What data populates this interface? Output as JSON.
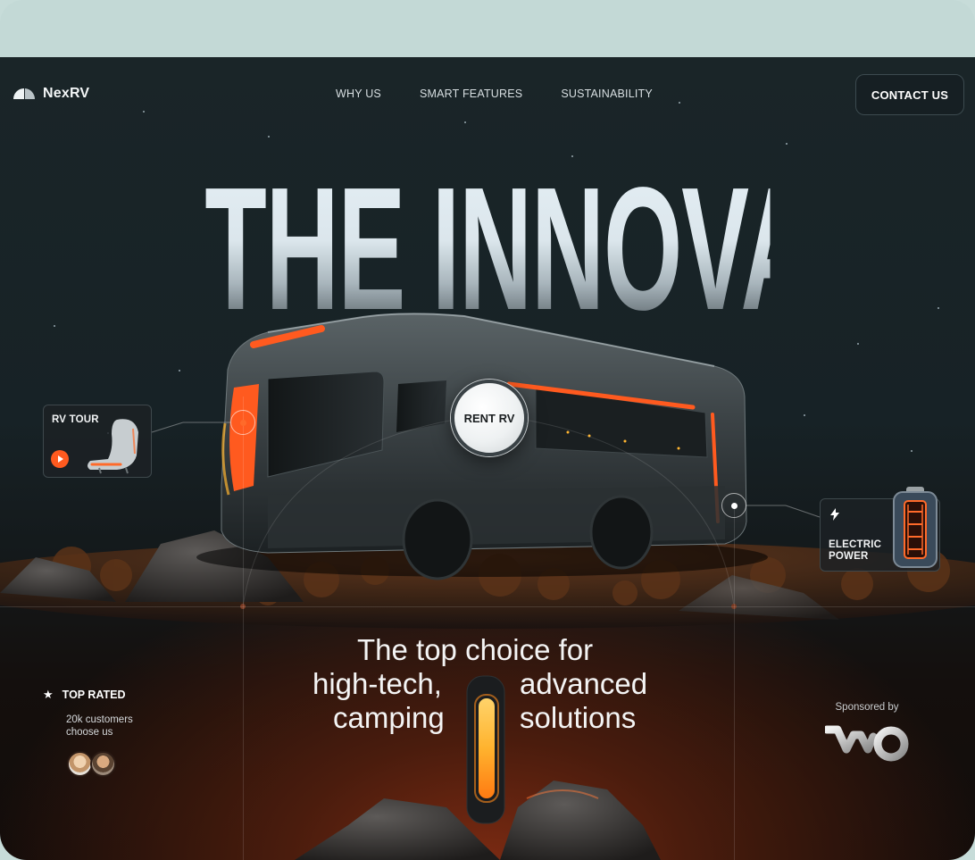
{
  "brand": {
    "name": "NexRV"
  },
  "nav": {
    "items": [
      {
        "label": "WHY US"
      },
      {
        "label": "SMART FEATURES"
      },
      {
        "label": "SUSTAINABILITY"
      }
    ],
    "contact_label": "CONTACT US"
  },
  "hero": {
    "headline": "THE INNOVATIVE TRAVEL",
    "rent_label": "RENT RV"
  },
  "callouts": {
    "tour": {
      "label": "RV TOUR"
    },
    "power": {
      "line1": "ELECTRIC",
      "line2": "POWER"
    }
  },
  "rating": {
    "title": "TOP RATED",
    "customers_line1": "20k customers",
    "customers_line2": "choose us"
  },
  "tagline": {
    "line1": "The top choice for",
    "line2_left": "high-tech,",
    "line2_right": "advanced",
    "line3_left": "camping",
    "line3_right": "solutions"
  },
  "sponsor": {
    "label": "Sponsored by"
  },
  "colors": {
    "accent": "#ff5a1f",
    "glow": "#ffb530",
    "background": "#172226",
    "frame_top": "#c3d9d6"
  }
}
